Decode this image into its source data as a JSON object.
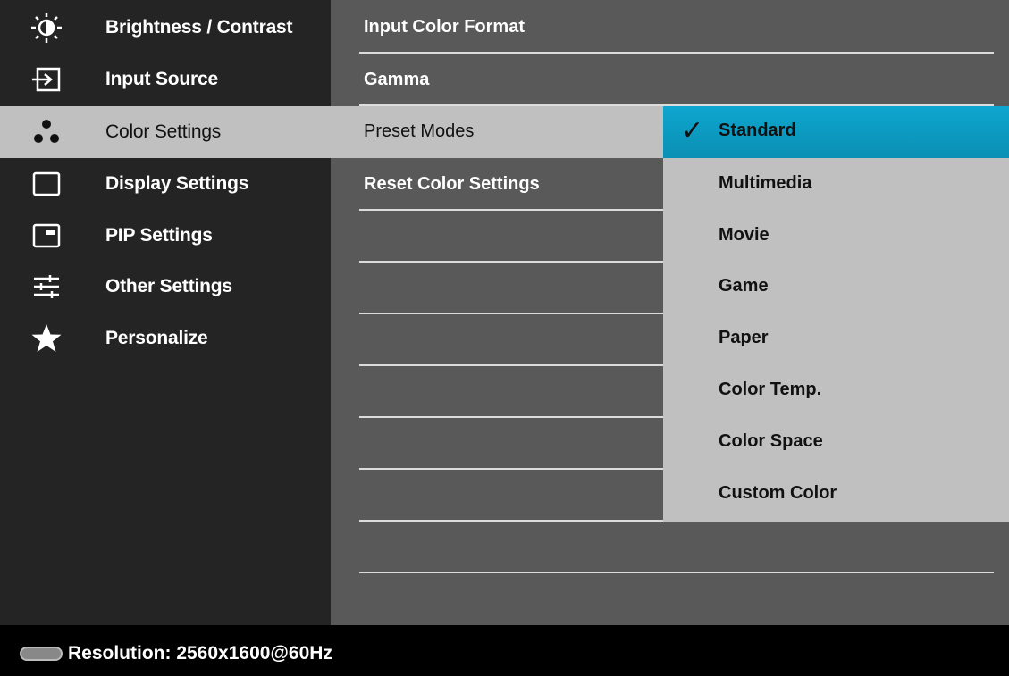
{
  "sidebar": {
    "items": [
      {
        "label": "Brightness / Contrast",
        "icon": "brightness-icon"
      },
      {
        "label": "Input Source",
        "icon": "input-source-icon"
      },
      {
        "label": "Color Settings",
        "icon": "color-settings-icon",
        "selected": true
      },
      {
        "label": "Display Settings",
        "icon": "display-icon"
      },
      {
        "label": "PIP Settings",
        "icon": "pip-icon"
      },
      {
        "label": "Other Settings",
        "icon": "sliders-icon"
      },
      {
        "label": "Personalize",
        "icon": "star-icon"
      }
    ]
  },
  "middle": {
    "items": [
      {
        "label": "Input Color Format"
      },
      {
        "label": "Gamma"
      },
      {
        "label": "Preset Modes",
        "selected": true
      },
      {
        "label": "Reset Color Settings"
      }
    ]
  },
  "submenu": {
    "items": [
      {
        "label": "Standard",
        "active": true,
        "checked": true
      },
      {
        "label": "Multimedia"
      },
      {
        "label": "Movie"
      },
      {
        "label": "Game"
      },
      {
        "label": "Paper"
      },
      {
        "label": "Color Temp."
      },
      {
        "label": "Color Space"
      },
      {
        "label": "Custom Color"
      }
    ]
  },
  "status": {
    "resolution": "Resolution: 2560x1600@60Hz"
  },
  "colors": {
    "sidebar_bg": "#242424",
    "middle_bg": "#595959",
    "selected_bg": "#c0c0c0",
    "active_accent": "#0b9dc4"
  }
}
